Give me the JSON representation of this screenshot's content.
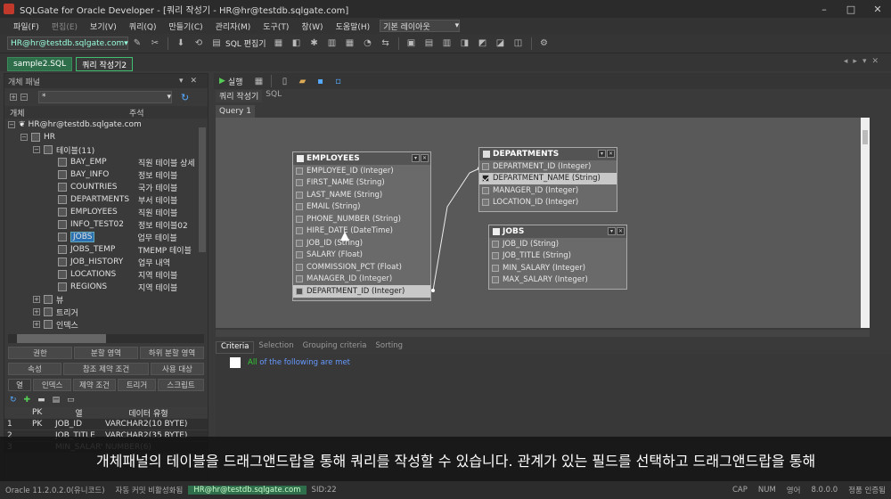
{
  "window": {
    "title": "SQLGate for Oracle Developer - [쿼리 작성기 - HR@hr@testdb.sqlgate.com]",
    "buttons": [
      "–",
      "□",
      "✕"
    ]
  },
  "menu": {
    "items": [
      "파일(F)",
      "편집(E)",
      "보기(V)",
      "쿼리(Q)",
      "만들기(C)",
      "관리자(M)",
      "도구(T)",
      "창(W)",
      "도움말(H)"
    ],
    "layout": "기본 레이아웃"
  },
  "toolbar": {
    "connection": "HR@hr@testdb.sqlgate.com",
    "sql_editor": "SQL 편집기"
  },
  "doc_tabs": [
    "sample2.SQL",
    "쿼리 작성기2"
  ],
  "left_panel": {
    "title": "개체 패널",
    "filter": "*",
    "col_object": "개체",
    "col_comment": "주석",
    "connection": "HR@hr@testdb.sqlgate.com",
    "schema": "HR",
    "tables_node": "테이블(11)",
    "tables": [
      {
        "name": "BAY_EMP",
        "comment": "직원 테이블 상세"
      },
      {
        "name": "BAY_INFO",
        "comment": "정보 테이블"
      },
      {
        "name": "COUNTRIES",
        "comment": "국가 테이블"
      },
      {
        "name": "DEPARTMENTS",
        "comment": "부서 테이블"
      },
      {
        "name": "EMPLOYEES",
        "comment": "직원 테이블"
      },
      {
        "name": "INFO_TEST02",
        "comment": "정보 테이블02"
      },
      {
        "name": "JOBS",
        "comment": "업무 테이블"
      },
      {
        "name": "JOBS_TEMP",
        "comment": "TMEMP 테이블"
      },
      {
        "name": "JOB_HISTORY",
        "comment": "업무 내역"
      },
      {
        "name": "LOCATIONS",
        "comment": "지역 테이블"
      },
      {
        "name": "REGIONS",
        "comment": "지역 테이블"
      }
    ],
    "other_nodes": [
      "뷰",
      "트리거",
      "인덱스"
    ],
    "btn_row1": [
      "권한",
      "분할 영역",
      "하위 분할 영역"
    ],
    "btn_row2": [
      "속성",
      "참조 제약 조건",
      "사용 대상"
    ],
    "btn_row3": [
      "열",
      "인덱스",
      "제약 조건",
      "트리거",
      "스크립트"
    ],
    "grid_headers": [
      "PK",
      "열",
      "데이터 유형"
    ],
    "grid_rows": [
      {
        "n": "1",
        "pk": "PK",
        "col": "JOB_ID",
        "type": "VARCHAR2(10 BYTE)"
      },
      {
        "n": "2",
        "pk": "",
        "col": "JOB_TITLE",
        "type": "VARCHAR2(35 BYTE)"
      },
      {
        "n": "3",
        "pk": "",
        "col": "MIN_SALARY",
        "type": "NUMBER(6)"
      }
    ]
  },
  "right_panel": {
    "run": "실행",
    "view_tabs": [
      "쿼리 작성기",
      "SQL"
    ],
    "query_tab": "Query 1",
    "bottom_tabs": [
      "Criteria",
      "Selection",
      "Grouping criteria",
      "Sorting"
    ],
    "criteria_all": "All",
    "criteria_rest": "of the following are met"
  },
  "entities": {
    "employees": {
      "title": "EMPLOYEES",
      "fields": [
        "EMPLOYEE_ID (Integer)",
        "FIRST_NAME (String)",
        "LAST_NAME (String)",
        "EMAIL (String)",
        "PHONE_NUMBER (String)",
        "HIRE_DATE (DateTime)",
        "JOB_ID (String)",
        "SALARY (Float)",
        "COMMISSION_PCT (Float)",
        "MANAGER_ID (Integer)",
        "DEPARTMENT_ID (Integer)"
      ]
    },
    "departments": {
      "title": "DEPARTMENTS",
      "fields": [
        "DEPARTMENT_ID (Integer)",
        "DEPARTMENT_NAME (String)",
        "MANAGER_ID (Integer)",
        "LOCATION_ID (Integer)"
      ]
    },
    "jobs": {
      "title": "JOBS",
      "fields": [
        "JOB_ID (String)",
        "JOB_TITLE (String)",
        "MIN_SALARY (Integer)",
        "MAX_SALARY (Integer)"
      ]
    }
  },
  "subtitle": "개체패널의 테이블을 드래그앤드랍을 통해 쿼리를 작성할 수 있습니다. 관계가 있는 필드를 선택하고 드래그앤드랍을 통해",
  "status": {
    "version": "Oracle 11.2.0.2.0(유니코드)",
    "commit": "자동 커밋 비활성화됨",
    "conn": "HR@hr@testdb.sqlgate.com",
    "sid": "SID:22",
    "cap": "CAP",
    "num": "NUM",
    "lang": "영어",
    "ver2": "8.0.0.0",
    "license": "정품 인증됨"
  }
}
